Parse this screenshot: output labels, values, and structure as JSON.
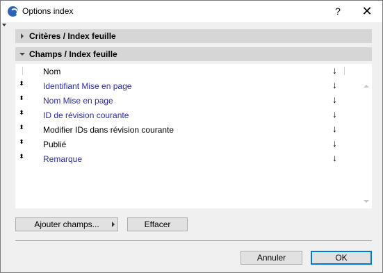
{
  "window": {
    "title": "Options index",
    "help": "?",
    "close": "✕"
  },
  "sections": {
    "criteria": {
      "label": "Critères / Index feuille"
    },
    "fields": {
      "label": "Champs / Index feuille"
    }
  },
  "list": {
    "header": {
      "label": "Nom",
      "sort": "↓"
    },
    "rows": [
      {
        "handle": "⬍",
        "label": "Identifiant Mise en page",
        "sort": "↓"
      },
      {
        "handle": "⬍",
        "label": "Nom Mise en page",
        "sort": "↓"
      },
      {
        "handle": "⬍",
        "label": "ID de révision courante",
        "sort": "↓"
      },
      {
        "handle": "⬍",
        "label": "Modifier IDs dans révision courante",
        "sort": "↓"
      },
      {
        "handle": "⬍",
        "label": "Publié",
        "sort": "↓"
      },
      {
        "handle": "⬍",
        "label": "Remarque",
        "sort": "↓"
      }
    ]
  },
  "buttons": {
    "add_fields": "Ajouter champs...",
    "clear": "Effacer",
    "cancel": "Annuler",
    "ok": "OK"
  },
  "colors": {
    "link_text": "#2b2bb0",
    "section_bg": "#d6d6d6",
    "primary_border": "#0078d7"
  }
}
